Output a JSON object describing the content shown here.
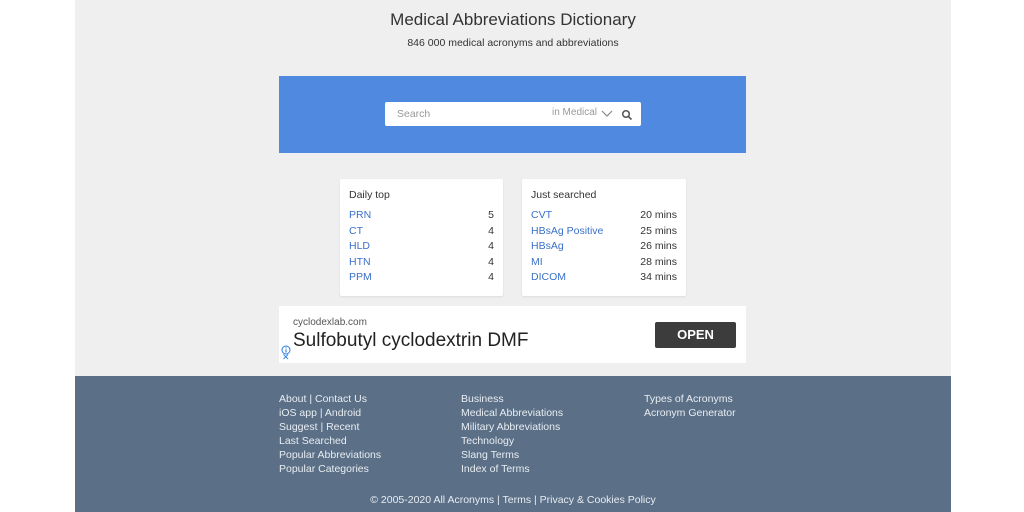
{
  "header": {
    "title": "Medical Abbreviations Dictionary",
    "subtitle": "846 000 medical acronyms and abbreviations"
  },
  "search": {
    "placeholder": "Search",
    "scope": "in Medical",
    "icons": [
      "chevron-down-icon",
      "search-icon"
    ],
    "panel_color": "#4f8ae0"
  },
  "daily_top": {
    "title": "Daily top",
    "items": [
      {
        "term": "PRN",
        "count": "5"
      },
      {
        "term": "CT",
        "count": "4"
      },
      {
        "term": "HLD",
        "count": "4"
      },
      {
        "term": "HTN",
        "count": "4"
      },
      {
        "term": "PPM",
        "count": "4"
      }
    ]
  },
  "just_searched": {
    "title": "Just searched",
    "items": [
      {
        "term": "CVT",
        "time": "20 mins"
      },
      {
        "term": "HBsAg Positive",
        "time": "25 mins"
      },
      {
        "term": "HBsAg",
        "time": "26 mins"
      },
      {
        "term": "MI",
        "time": "28 mins"
      },
      {
        "term": "DICOM",
        "time": "34 mins"
      }
    ]
  },
  "ad": {
    "domain": "cyclodexlab.com",
    "headline": "Sulfobutyl cyclodextrin DMF",
    "button": "OPEN",
    "close": "✕"
  },
  "footer": {
    "col1": [
      "About | Contact Us",
      "iOS app | Android",
      "Suggest | Recent",
      "Last Searched",
      "Popular Abbreviations",
      "Popular Categories"
    ],
    "col2": [
      "Business",
      "Medical Abbreviations",
      "Military Abbreviations",
      "Technology",
      "Slang Terms",
      "Index of Terms"
    ],
    "col3": [
      "Types of Acronyms",
      "Acronym Generator"
    ],
    "copyright": "© 2005-2020 All Acronyms | Terms | Privacy & Cookies Policy",
    "background_color": "#5b6f86"
  },
  "colors": {
    "link": "#3a70c9",
    "page_bg": "#efefef"
  }
}
